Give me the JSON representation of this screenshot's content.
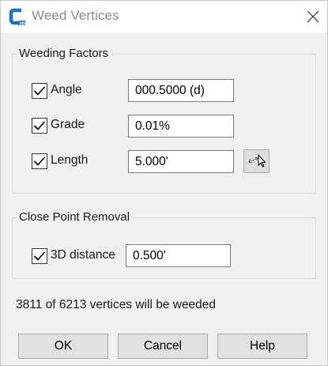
{
  "window": {
    "title": "Weed Vertices",
    "app_icon": "civil3d-app-icon",
    "close_icon": "close-icon"
  },
  "weeding_factors": {
    "legend": "Weeding Factors",
    "angle": {
      "label": "Angle",
      "checked": true,
      "value": "000.5000 (d)"
    },
    "grade": {
      "label": "Grade",
      "checked": true,
      "value": "0.01%"
    },
    "length": {
      "label": "Length",
      "checked": true,
      "value": "5.000'",
      "pick_icon": "pick-distance-icon"
    }
  },
  "close_point_removal": {
    "legend": "Close Point Removal",
    "distance_3d": {
      "label": "3D distance",
      "checked": true,
      "value": "0.500'"
    }
  },
  "status": {
    "text": "3811 of 6213 vertices will be weeded"
  },
  "buttons": {
    "ok": "OK",
    "cancel": "Cancel",
    "help": "Help"
  },
  "colors": {
    "dialog_bg": "#f0f0f0",
    "titlebar_bg": "#ffffff",
    "icon_blue": "#1e73be",
    "button_bg": "#e1e1e1"
  }
}
